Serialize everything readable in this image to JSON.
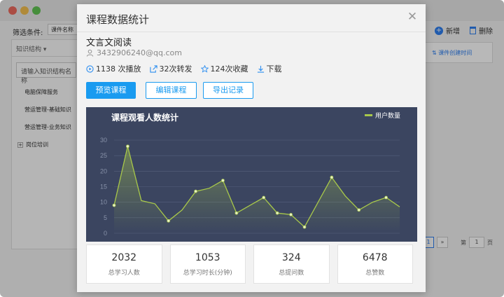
{
  "bg": {
    "filter_label": "筛选条件:",
    "filter_select": "课件名称",
    "add_label": "新增",
    "delete_label": "删除",
    "sidebar_head": "知识结构 ▾",
    "sidebar_search_placeholder": "请输入知识结构名称",
    "tree": [
      "电脑保障服务",
      "营运管理-基础知识",
      "营运管理-业务知识",
      "岗位培训"
    ],
    "right_col_header": "课件创建时间",
    "pager": {
      "page_num": "1",
      "next": "»",
      "goto_prefix": "第",
      "goto_value": "1",
      "goto_suffix": "页"
    }
  },
  "modal": {
    "title": "课程数据统计",
    "course_name": "文言文阅读",
    "email": "3432906240@qq.com",
    "stats": [
      {
        "icon": "play-icon",
        "text": "1138 次播放"
      },
      {
        "icon": "share-icon",
        "text": "32次转发"
      },
      {
        "icon": "star-icon",
        "text": "124次收藏"
      },
      {
        "icon": "download-icon",
        "text": "下载"
      }
    ],
    "buttons": {
      "preview": "预览课程",
      "edit": "编辑课程",
      "export": "导出记录"
    },
    "summary": [
      {
        "value": "2032",
        "label": "总学习人数"
      },
      {
        "value": "1053",
        "label": "总学习时长(分钟)"
      },
      {
        "value": "324",
        "label": "总提问数"
      },
      {
        "value": "6478",
        "label": "总赞数"
      }
    ]
  },
  "colors": {
    "accent": "#1a9bf0",
    "chart_bg": "#3b4560",
    "line": "#a8c84a"
  },
  "chart_data": {
    "type": "area",
    "title": "课程观看人数统计",
    "series": [
      {
        "name": "用户数量",
        "x": [
          0,
          1,
          2,
          3,
          4,
          5,
          6,
          7,
          8,
          9,
          10,
          11,
          12,
          13,
          14,
          15,
          16,
          17,
          18,
          19,
          20,
          21
        ],
        "values": [
          9,
          28,
          10.5,
          9.5,
          4,
          7.5,
          13.5,
          14.5,
          17,
          6.5,
          9,
          11.5,
          6.5,
          6,
          2,
          10,
          18,
          12,
          7.5,
          10,
          11.5,
          8.5
        ]
      }
    ],
    "yticks": [
      "0",
      "5",
      "10",
      "15",
      "20",
      "25",
      "30"
    ],
    "ylim": [
      0,
      30
    ],
    "grid": true,
    "legend": "top-right"
  }
}
